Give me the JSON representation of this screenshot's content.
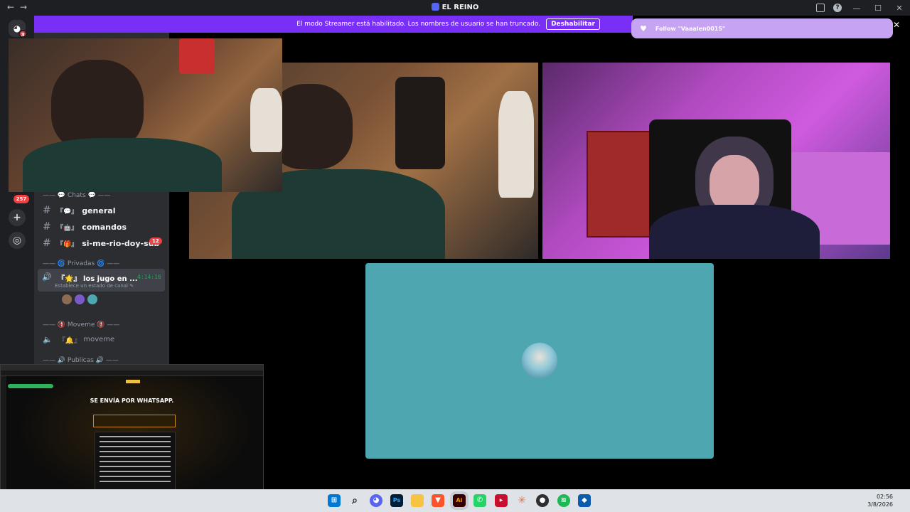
{
  "titlebar": {
    "title": "EL REINO",
    "back_icon": "arrow-left-icon",
    "forward_icon": "arrow-right-icon",
    "window_controls": [
      "—",
      "☐",
      "✕"
    ]
  },
  "rail": {
    "discord_badge": "3",
    "mention_count": "257",
    "add_server_icon": "+",
    "explore_icon": "compass-icon"
  },
  "streamer_banner": {
    "message": "El modo Streamer está habilitado. Los nombres de usuario se han truncado.",
    "button": "Deshabilitar",
    "color": "#7a2ff7"
  },
  "toast": {
    "text": "Follow \"Vaaalen0015\"",
    "color": "#c7a3f4"
  },
  "channels": {
    "categories": [
      {
        "label": "—— 💬 Chats 💬 ——"
      },
      {
        "label": "—— 🌀 Privadas 🌀 ——"
      },
      {
        "label": "—— 🚯 Moveme 🚯 ——"
      },
      {
        "label": "—— 🔊 Publicas 🔊 ——"
      }
    ],
    "text_channels": [
      {
        "emoji": "『💬』",
        "name": "general"
      },
      {
        "emoji": "『🤖』",
        "name": "comandos"
      },
      {
        "emoji": "『🎁』",
        "name": "si-me-rio-doy-sub",
        "badge": "12"
      }
    ],
    "active_voice": {
      "emoji": "『🌟』",
      "name": "los jugo en ...",
      "time": "4:14:16",
      "status": "Establece un estado de canal ✎"
    },
    "voice_channels": [
      {
        "emoji": "『🔔』",
        "name": "moveme"
      }
    ]
  },
  "browser_preview": {
    "headline": "SE ENVÍA POR WHATSAPP."
  },
  "taskbar": {
    "clock_time": "02:56",
    "clock_date": "3/8/2026",
    "apps": [
      "windows-icon",
      "search-icon",
      "discord-icon",
      "photoshop-icon",
      "file-explorer-icon",
      "brave-icon",
      "illustrator-icon",
      "whatsapp-icon",
      "video-editor-icon",
      "claude-icon",
      "obs-icon",
      "spotify-icon",
      "vpn-icon"
    ]
  },
  "colors": {
    "audio_tile": "#4ea7b0",
    "accent": "#5865f2",
    "voice_green": "#23a55a",
    "mention_red": "#f23f43"
  }
}
